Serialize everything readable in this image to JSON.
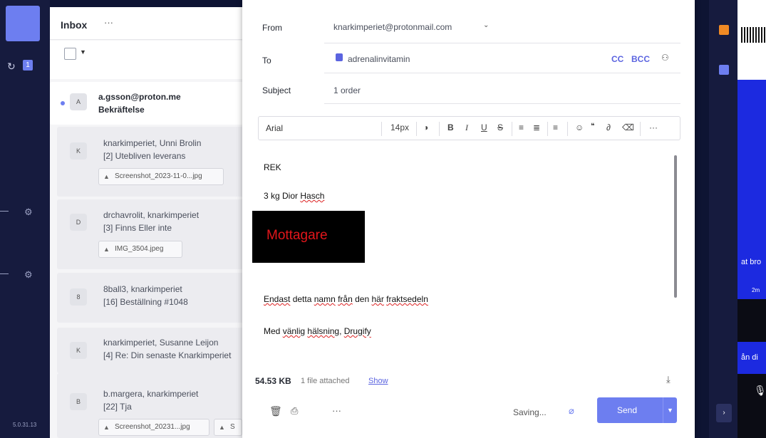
{
  "rail": {
    "badge": "1",
    "version": "5.0.31.13"
  },
  "inbox": {
    "title": "Inbox",
    "more": "···",
    "items": [
      {
        "avatar": "A",
        "sender": "a.gsson@proton.me",
        "subject": "Bekräftelse",
        "unread": true
      },
      {
        "avatar": "K",
        "sender": "knarkimperiet, Unni Brolin",
        "subject": "[2] Utebliven leverans",
        "attachments": [
          "Screenshot_2023-11-0...jpg"
        ]
      },
      {
        "avatar": "D",
        "sender": "drchavrolit, knarkimperiet",
        "subject": "[3] Finns Eller inte",
        "attachments": [
          "IMG_3504.jpeg"
        ]
      },
      {
        "avatar": "8",
        "sender": "8ball3, knarkimperiet",
        "subject": "[16] Beställning #1048"
      },
      {
        "avatar": "K",
        "sender": "knarkimperiet, Susanne Leijon",
        "subject": "[4] Re: Din senaste Knarkimperiet"
      },
      {
        "avatar": "B",
        "sender": "b.margera, knarkimperiet",
        "subject": "[22] Tja",
        "attachments": [
          "Screenshot_20231...jpg",
          "S"
        ]
      }
    ]
  },
  "composer": {
    "from_label": "From",
    "from_value": "knarkimperiet@protonmail.com",
    "to_label": "To",
    "to_value": "adrenalinvitamin",
    "cc": "CC",
    "bcc": "BCC",
    "subject_label": "Subject",
    "subject_value": "1 order",
    "toolbar": {
      "font": "Arial",
      "size": "14px"
    },
    "body": {
      "line1": "REK",
      "line2_a": "3 kg Dior ",
      "line2_b": "Hasch",
      "box_text": "Mottagare",
      "line3_a": "Endast",
      "line3_b": " detta ",
      "line3_c": "namn",
      "line3_d": " ",
      "line3_e": "från",
      "line3_f": " den ",
      "line3_g": "här",
      "line3_h": " ",
      "line3_i": "fraktsedeln",
      "line4_a": "Med ",
      "line4_b": "vänlig",
      "line4_c": " ",
      "line4_d": "hälsning",
      "line4_e": ", ",
      "line4_f": "Drugify"
    },
    "attachment_size": "54.53 KB",
    "attachment_count": "1 file attached",
    "show": "Show",
    "saving": "Saving...",
    "send": "Send"
  },
  "right": {
    "t1": "at bro",
    "t2": "2m",
    "t3": "ån di"
  },
  "colors": {
    "accent": "#6d7ef0",
    "dark": "#161b3e",
    "red_text": "#e3161b"
  }
}
